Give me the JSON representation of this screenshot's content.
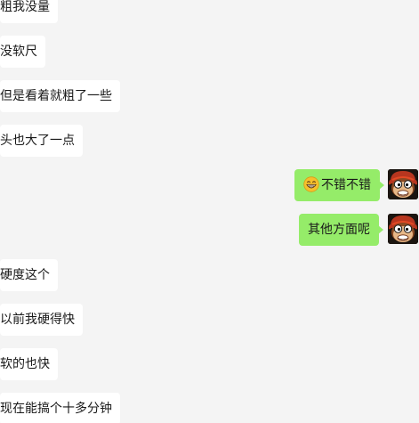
{
  "conversation": {
    "incoming_top": [
      {
        "text": "粗我没量"
      },
      {
        "text": "没软尺"
      },
      {
        "text": "但是看着就粗了一些"
      },
      {
        "text": "头也大了一点"
      }
    ],
    "outgoing": [
      {
        "emoji": "grin-emoji",
        "text": "不错不错"
      },
      {
        "text": "其他方面呢"
      }
    ],
    "incoming_bottom": [
      {
        "text": "硬度这个"
      },
      {
        "text": "以前我硬得快"
      },
      {
        "text": "软的也快"
      },
      {
        "text": "现在能搞个十多分钟"
      }
    ]
  },
  "colors": {
    "background": "#f4f4f4",
    "incoming_bubble": "#ffffff",
    "outgoing_bubble": "#95ec69",
    "text": "#191919"
  }
}
